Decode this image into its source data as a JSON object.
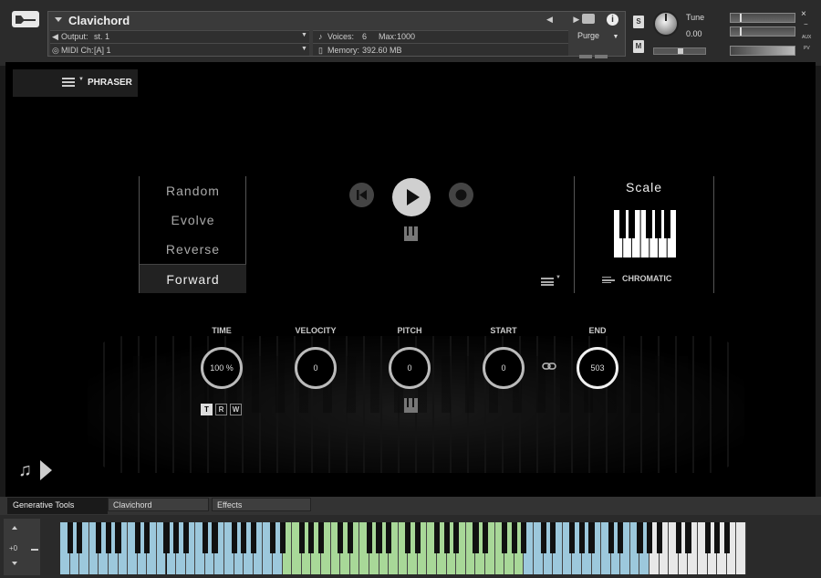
{
  "instrument": {
    "title": "Clavichord",
    "output_label": "Output:",
    "output_value": "st. 1",
    "midi_label": "MIDI Ch:",
    "midi_value": "[A]  1",
    "voices_label": "Voices:",
    "voices_value": "6",
    "max_label": "Max:",
    "max_value": "1000",
    "memory_label": "Memory:",
    "memory_value": "392.60 MB",
    "purge_label": "Purge",
    "solo_label": "S",
    "mute_label": "M",
    "tune_label": "Tune",
    "tune_value": "0.00",
    "aux_label": "AUX",
    "pv_label": "PV",
    "close_label": "×",
    "minus_label": "−",
    "info_label": "i",
    "prev_next": "◀ ▶"
  },
  "phraser": {
    "tab_label": "PHRASER"
  },
  "modes": [
    "Random",
    "Evolve",
    "Reverse",
    "Forward"
  ],
  "active_mode": "Forward",
  "scale": {
    "title": "Scale",
    "name": "CHROMATIC"
  },
  "params": [
    {
      "label": "TIME",
      "value": "100 %"
    },
    {
      "label": "VELOCITY",
      "value": "0"
    },
    {
      "label": "PITCH",
      "value": "0"
    },
    {
      "label": "START",
      "value": "0"
    },
    {
      "label": "END",
      "value": "503"
    }
  ],
  "trw": [
    "T",
    "R",
    "W"
  ],
  "tabs": [
    "Generative Tools",
    "Clavichord",
    "Effects"
  ],
  "keyboard": {
    "octave_label": "+0",
    "colors": {
      "blue": "#9cc8dc",
      "green": "#a8d898",
      "white": "#e8e8e8"
    }
  }
}
